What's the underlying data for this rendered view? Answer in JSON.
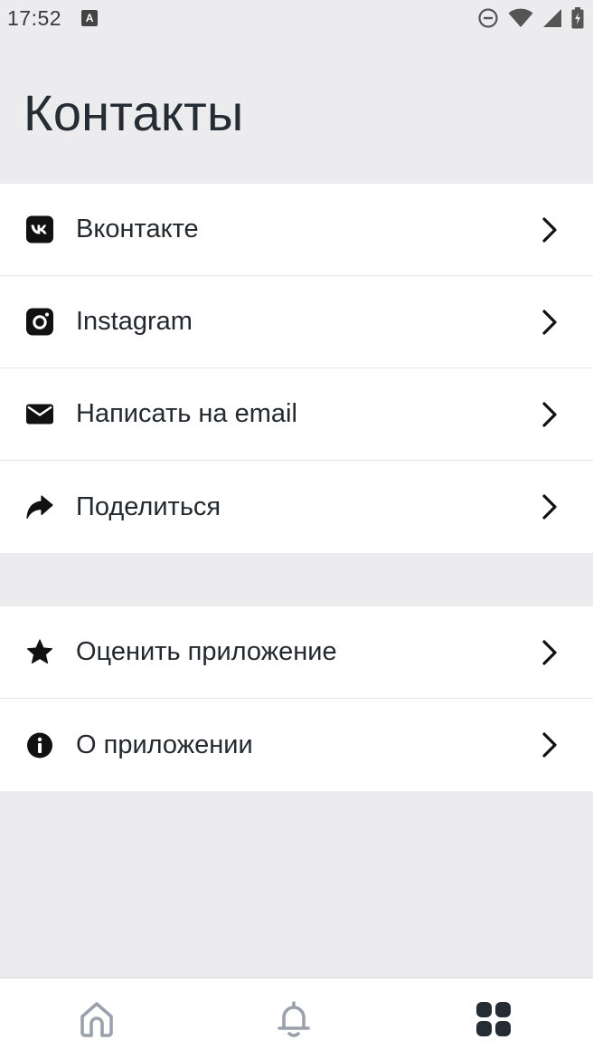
{
  "status_bar": {
    "time": "17:52",
    "keyboard_badge": "A"
  },
  "header": {
    "title": "Контакты"
  },
  "groups": [
    {
      "items": [
        {
          "label": "Вконтакте",
          "icon": "vk-icon"
        },
        {
          "label": "Instagram",
          "icon": "instagram-icon"
        },
        {
          "label": "Написать на email",
          "icon": "mail-icon"
        },
        {
          "label": "Поделиться",
          "icon": "share-icon"
        }
      ]
    },
    {
      "items": [
        {
          "label": "Оценить приложение",
          "icon": "star-icon"
        },
        {
          "label": "О приложении",
          "icon": "info-icon"
        }
      ]
    }
  ],
  "bottom_nav": {
    "items": [
      {
        "icon": "home-icon",
        "active": false
      },
      {
        "icon": "bell-icon",
        "active": false
      },
      {
        "icon": "grid-icon",
        "active": true
      }
    ]
  },
  "colors": {
    "background": "#ececee",
    "text": "#24292f",
    "inactive_nav": "#9aa1ab",
    "active_nav": "#262c33"
  }
}
